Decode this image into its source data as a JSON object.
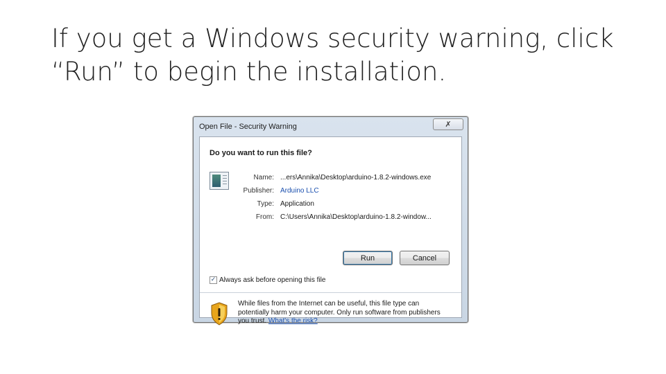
{
  "slide": {
    "title": "If you get a Windows security warning, click “Run” to begin the installation."
  },
  "dialog": {
    "title": "Open File - Security Warning",
    "close_glyph": "✗",
    "question": "Do you want to run this file?",
    "fields": [
      {
        "label": "Name:",
        "value": "...ers\\Annika\\Desktop\\arduino-1.8.2-windows.exe",
        "is_link": false
      },
      {
        "label": "Publisher:",
        "value": "Arduino LLC",
        "is_link": true
      },
      {
        "label": "Type:",
        "value": "Application",
        "is_link": false
      },
      {
        "label": "From:",
        "value": "C:\\Users\\Annika\\Desktop\\arduino-1.8.2-window...",
        "is_link": false
      }
    ],
    "run_label": "Run",
    "cancel_label": "Cancel",
    "checkbox": {
      "label": "Always ask before opening this file",
      "checked": true,
      "check_glyph": "✓"
    },
    "warning": {
      "text": "While files from the Internet can be useful, this file type can potentially harm your computer. Only run software from publishers you trust.",
      "link_label": "What's the risk?"
    }
  },
  "icons": {
    "file": "application-file-icon",
    "shield": "security-shield-icon",
    "close": "close-icon"
  },
  "colors": {
    "link": "#1a4fae",
    "shield_gold": "#e8a51c",
    "dialog_frame": "#c9d6e4"
  }
}
